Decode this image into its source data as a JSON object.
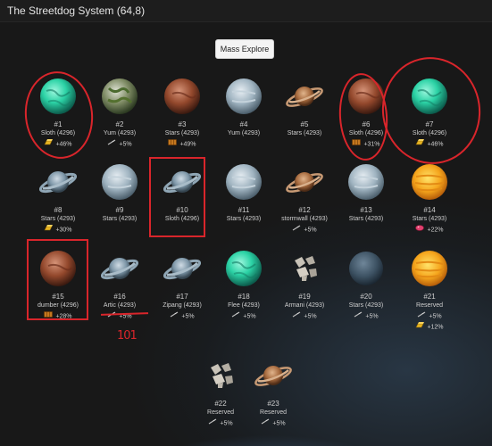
{
  "window": {
    "title": "The Streetdog System (64,8)"
  },
  "toolbar": {
    "mass_explore_label": "Mass Explore"
  },
  "colors": {
    "annotation_red": "#d9252b",
    "background": "#181818"
  },
  "annotations": {
    "scribble": "101"
  },
  "planets": [
    {
      "number": "#1",
      "name": "Sloth (4296)",
      "type": "teal",
      "bonuses": [
        {
          "icon": "gold-bar-icon",
          "text": "+46%"
        }
      ]
    },
    {
      "number": "#2",
      "name": "Yum (4293)",
      "type": "forest",
      "bonuses": [
        {
          "icon": "feather-icon",
          "text": "+5%"
        }
      ]
    },
    {
      "number": "#3",
      "name": "Stars (4293)",
      "type": "mars",
      "bonuses": [
        {
          "icon": "crate-icon",
          "text": "+49%"
        }
      ]
    },
    {
      "number": "#4",
      "name": "Yum (4293)",
      "type": "ice",
      "bonuses": []
    },
    {
      "number": "#5",
      "name": "Stars (4293)",
      "type": "saturn",
      "bonuses": []
    },
    {
      "number": "#6",
      "name": "Sloth (4296)",
      "type": "mars",
      "bonuses": [
        {
          "icon": "crate-icon",
          "text": "+31%"
        }
      ]
    },
    {
      "number": "#7",
      "name": "Sloth (4296)",
      "type": "teal",
      "bonuses": [
        {
          "icon": "gold-bar-icon",
          "text": "+46%"
        }
      ]
    },
    {
      "number": "#8",
      "name": "Stars (4293)",
      "type": "ringice",
      "bonuses": [
        {
          "icon": "gold-bar-icon",
          "text": "+30%"
        }
      ]
    },
    {
      "number": "#9",
      "name": "Stars (4293)",
      "type": "ice",
      "bonuses": []
    },
    {
      "number": "#10",
      "name": "Sloth (4296)",
      "type": "ringice",
      "bonuses": []
    },
    {
      "number": "#11",
      "name": "Stars (4293)",
      "type": "ice",
      "bonuses": []
    },
    {
      "number": "#12",
      "name": "stormwall (4293)",
      "type": "saturn",
      "bonuses": [
        {
          "icon": "feather-icon",
          "text": "+5%"
        }
      ]
    },
    {
      "number": "#13",
      "name": "Stars (4293)",
      "type": "ice",
      "bonuses": []
    },
    {
      "number": "#14",
      "name": "Stars (4293)",
      "type": "sun",
      "bonuses": [
        {
          "icon": "gem-icon",
          "text": "+22%"
        }
      ]
    },
    {
      "number": "#15",
      "name": "dumber (4296)",
      "type": "mars",
      "bonuses": [
        {
          "icon": "crate-icon",
          "text": "+28%"
        }
      ]
    },
    {
      "number": "#16",
      "name": "Artic (4293)",
      "type": "ringice",
      "bonuses": [
        {
          "icon": "feather-icon",
          "text": "+5%"
        }
      ]
    },
    {
      "number": "#17",
      "name": "Zipang (4293)",
      "type": "ringice",
      "bonuses": [
        {
          "icon": "feather-icon",
          "text": "+5%"
        }
      ]
    },
    {
      "number": "#18",
      "name": "Flee (4293)",
      "type": "teal",
      "bonuses": [
        {
          "icon": "feather-icon",
          "text": "+5%"
        }
      ]
    },
    {
      "number": "#19",
      "name": "Armani (4293)",
      "type": "rocks",
      "bonuses": [
        {
          "icon": "feather-icon",
          "text": "+5%"
        }
      ]
    },
    {
      "number": "#20",
      "name": "Stars (4293)",
      "type": "dim",
      "bonuses": [
        {
          "icon": "feather-icon",
          "text": "+5%"
        }
      ]
    },
    {
      "number": "#21",
      "name": "Reserved",
      "type": "sun",
      "bonuses": [
        {
          "icon": "feather-icon",
          "text": "+5%"
        },
        {
          "icon": "gold-bar-icon",
          "text": "+12%"
        }
      ]
    },
    {
      "number": "#22",
      "name": "Reserved",
      "type": "rocks",
      "bonuses": [
        {
          "icon": "feather-icon",
          "text": "+5%"
        }
      ]
    },
    {
      "number": "#23",
      "name": "Reserved",
      "type": "saturn",
      "bonuses": [
        {
          "icon": "feather-icon",
          "text": "+5%"
        }
      ]
    }
  ]
}
